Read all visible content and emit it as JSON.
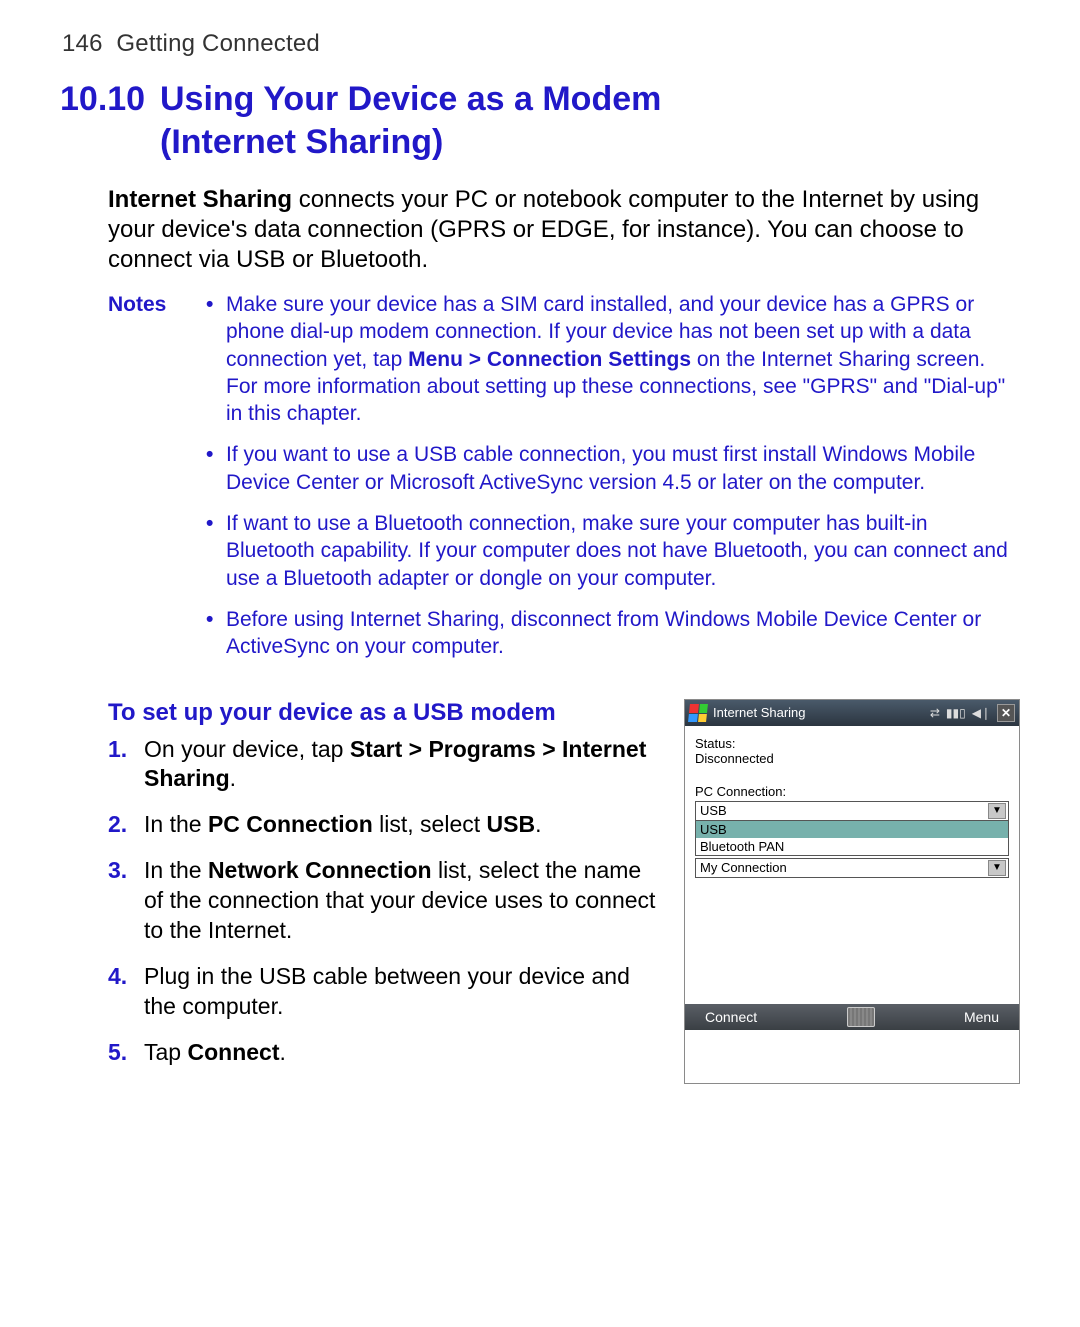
{
  "page_number": "146",
  "running_head": "Getting Connected",
  "section_number": "10.10",
  "section_title_line1": "Using Your Device as a Modem",
  "section_title_line2": "(Internet Sharing)",
  "intro_prefix_bold": "Internet Sharing",
  "intro_rest": " connects your PC or notebook computer to the Internet by using your device's data connection (GPRS or EDGE, for instance). You can choose to connect via USB or Bluetooth.",
  "notes_label": "Notes",
  "notes": [
    {
      "pre": "Make sure your device has a SIM card installed, and your device has a GPRS or phone dial-up modem connection. If your device has not been set up with a data connection yet, tap ",
      "bold": "Menu > Connection Settings",
      "post": " on the Internet Sharing screen. For more information about setting up these connections, see \"GPRS\" and \"Dial-up\" in this chapter."
    },
    {
      "pre": "If you want to use a USB cable connection, you must first install Windows Mobile Device Center or Microsoft ActiveSync version 4.5 or later on the computer.",
      "bold": "",
      "post": ""
    },
    {
      "pre": "If want to use a Bluetooth connection, make sure your computer has built-in Bluetooth capability. If your computer does not have Bluetooth, you can connect and use a Bluetooth adapter or dongle on your computer.",
      "bold": "",
      "post": ""
    },
    {
      "pre": "Before using Internet Sharing, disconnect from Windows Mobile Device Center or ActiveSync on your computer.",
      "bold": "",
      "post": ""
    }
  ],
  "subhead": "To set up your device as a USB modem",
  "steps": [
    {
      "pre": "On your device, tap ",
      "b": "Start > Programs > Internet Sharing",
      "post": "."
    },
    {
      "pre": "In the ",
      "b": "PC Connection",
      "post": " list, select ",
      "b2": "USB",
      "post2": "."
    },
    {
      "pre": "In the ",
      "b": "Network Connection",
      "post": " list, select the name of the connection that your device uses to connect to the Internet."
    },
    {
      "pre": "Plug in the USB cable between your device and the computer.",
      "b": "",
      "post": ""
    },
    {
      "pre": "Tap ",
      "b": "Connect",
      "post": "."
    }
  ],
  "device": {
    "title": "Internet Sharing",
    "status_label": "Status:",
    "status_value": "Disconnected",
    "pc_conn_label": "PC Connection:",
    "pc_conn_value": "USB",
    "options": [
      "USB",
      "Bluetooth PAN"
    ],
    "net_conn_value": "My Connection",
    "soft_left": "Connect",
    "soft_right": "Menu"
  }
}
